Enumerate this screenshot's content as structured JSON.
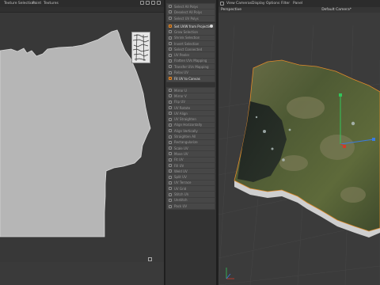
{
  "uv_editor": {
    "menu": [
      "Texture Selection",
      "Paint",
      "Textures"
    ]
  },
  "command_panel": {
    "groups": [
      {
        "items": [
          {
            "label": "Select All Polys",
            "bright": false
          },
          {
            "label": "Deselect All Polys",
            "bright": false
          },
          {
            "label": "Select UV Polys",
            "bright": false
          }
        ]
      },
      {
        "items": [
          {
            "label": "Set UVW from Projection",
            "bright": true,
            "dot": true
          },
          {
            "label": "Grow Selection",
            "bright": false
          },
          {
            "label": "Shrink Selection",
            "bright": false
          },
          {
            "label": "Invert Selection",
            "bright": false
          },
          {
            "label": "Select Connected",
            "bright": false
          },
          {
            "label": "UV Peeler",
            "bright": false
          },
          {
            "label": "Flatten UVs Mapping",
            "bright": false
          },
          {
            "label": "Transfer UVs Mapping",
            "bright": false
          },
          {
            "label": "Relax UV",
            "bright": false
          },
          {
            "label": "Fit UV to Canvas",
            "bright": true
          }
        ]
      },
      {
        "items": [
          {
            "label": "Mirror U",
            "bright": false
          },
          {
            "label": "Mirror V",
            "bright": false
          },
          {
            "label": "Flip UV",
            "bright": false
          },
          {
            "label": "UV Rotate",
            "bright": false
          },
          {
            "label": "UV Align",
            "bright": false
          },
          {
            "label": "UV Straighten",
            "bright": false
          },
          {
            "label": "Align Horizontally",
            "bright": false
          },
          {
            "label": "Align Vertically",
            "bright": false
          },
          {
            "label": "Straighten All",
            "bright": false
          },
          {
            "label": "Rectangularize",
            "bright": false
          },
          {
            "label": "Optimize UV",
            "bright": false
          }
        ]
      },
      {
        "items": [
          {
            "label": "Scale UV",
            "bright": false
          },
          {
            "label": "Move UV",
            "bright": false
          },
          {
            "label": "Fit UV",
            "bright": false
          },
          {
            "label": "Fill UV",
            "bright": false
          },
          {
            "label": "Weld UV",
            "bright": false
          },
          {
            "label": "Split UV",
            "bright": false
          },
          {
            "label": "UV Terrace",
            "bright": false
          },
          {
            "label": "UV Grid",
            "bright": false
          },
          {
            "label": "Stitch UV",
            "bright": false
          },
          {
            "label": "Unstitch",
            "bright": false
          },
          {
            "label": "Pack UV",
            "bright": false
          }
        ]
      }
    ]
  },
  "viewport": {
    "menu": [
      "View",
      "Cameras",
      "Display",
      "Options",
      "Filter",
      "Panel"
    ],
    "view_label": "Perspective",
    "camera_label": "Default Camera",
    "camera_suffix": "*"
  },
  "colors": {
    "accent_orange": "#e08a2a",
    "gizmo_green": "#33c45a",
    "gizmo_blue": "#3a7be0",
    "gizmo_red": "#d23a2a"
  }
}
